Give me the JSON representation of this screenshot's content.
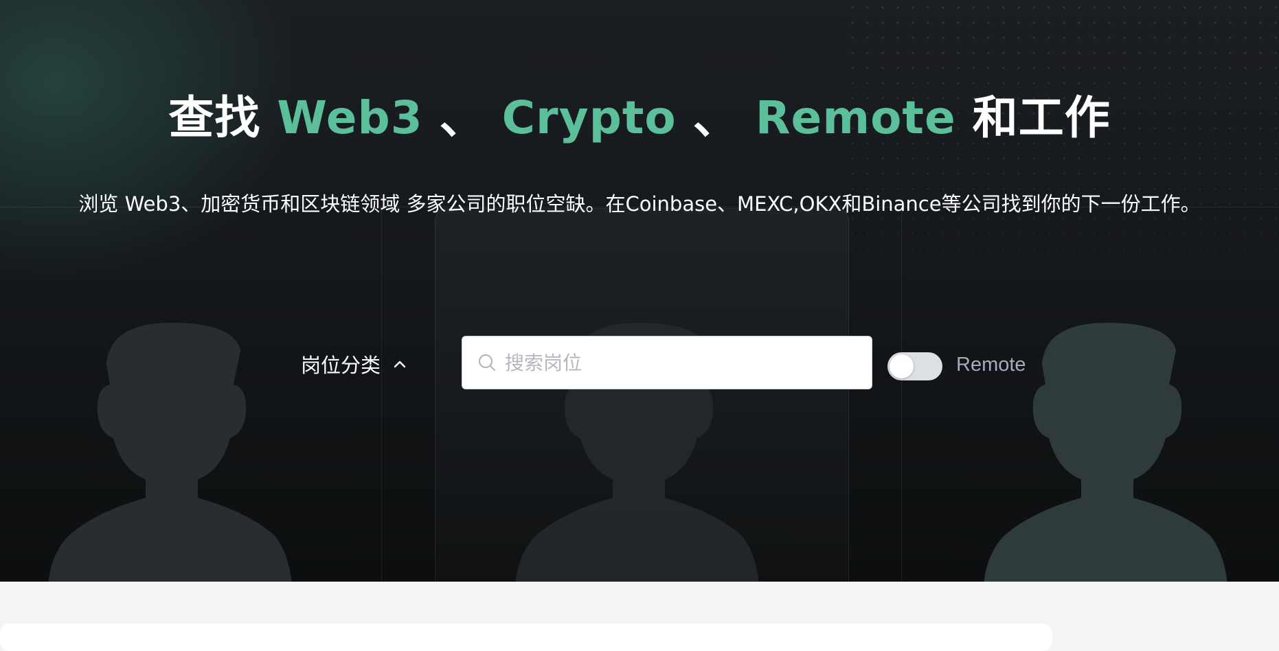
{
  "hero": {
    "title": {
      "prefix": "查找",
      "kw1": "Web3",
      "sep1": "、",
      "kw2": "Crypto",
      "sep2": "、",
      "kw3": "Remote",
      "suffix": "和工作"
    },
    "subtitle": "浏览 Web3、加密货币和区块链领域 多家公司的职位空缺。在Coinbase、MEXC,OKX和Binance等公司找到你的下一份工作。"
  },
  "filters": {
    "category_label": "岗位分类",
    "category_icon": "chevron-up-icon",
    "search": {
      "placeholder": "搜索岗位",
      "value": "",
      "icon": "search-icon"
    },
    "remote_toggle": {
      "label": "Remote",
      "on": false
    }
  },
  "colors": {
    "accent": "#5bbf9a",
    "hero_bg": "#15181b",
    "page_bg": "#f4f5f7",
    "toggle_off": "#dcdfe4",
    "muted_text": "#a4adbb"
  }
}
